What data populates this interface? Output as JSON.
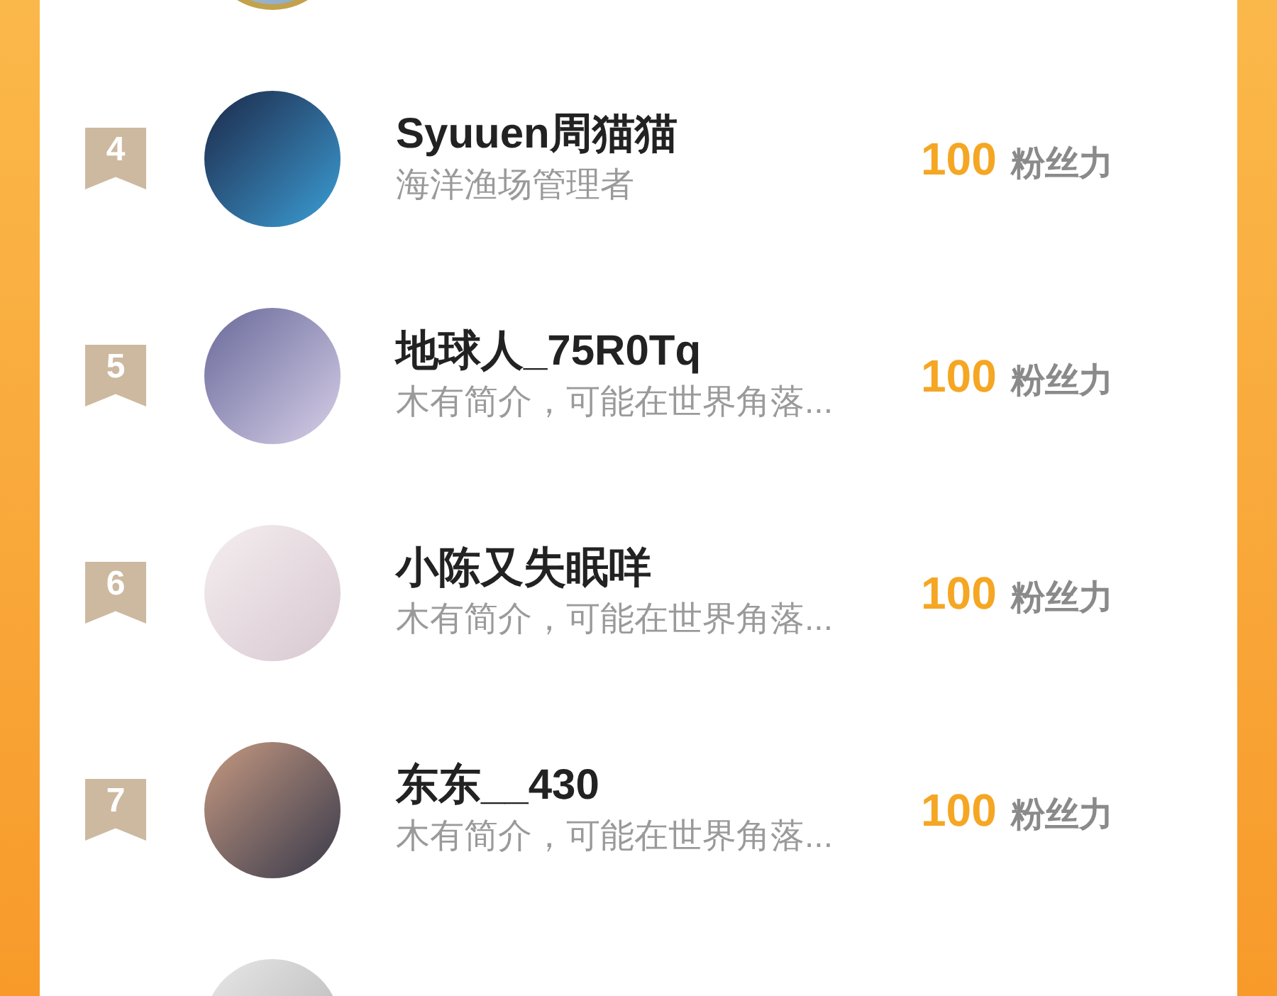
{
  "rows": [
    {
      "kind": "avatar_only",
      "ring": true
    },
    {
      "kind": "full",
      "ring": false,
      "rank": "4",
      "name": "Syuuen周猫猫",
      "bio": "海洋渔场管理者",
      "score": "100",
      "unit": "粉丝力"
    },
    {
      "kind": "full",
      "ring": false,
      "rank": "5",
      "name": "地球人_75R0Tq",
      "bio": "木有简介，可能在世界角落...",
      "score": "100",
      "unit": "粉丝力"
    },
    {
      "kind": "full",
      "ring": false,
      "rank": "6",
      "name": "小陈又失眠咩",
      "bio": "木有简介，可能在世界角落...",
      "score": "100",
      "unit": "粉丝力"
    },
    {
      "kind": "full",
      "ring": false,
      "rank": "7",
      "name": "东东__430",
      "bio": "木有简介，可能在世界角落...",
      "score": "100",
      "unit": "粉丝力"
    },
    {
      "kind": "avatar_only",
      "ring": false
    }
  ]
}
